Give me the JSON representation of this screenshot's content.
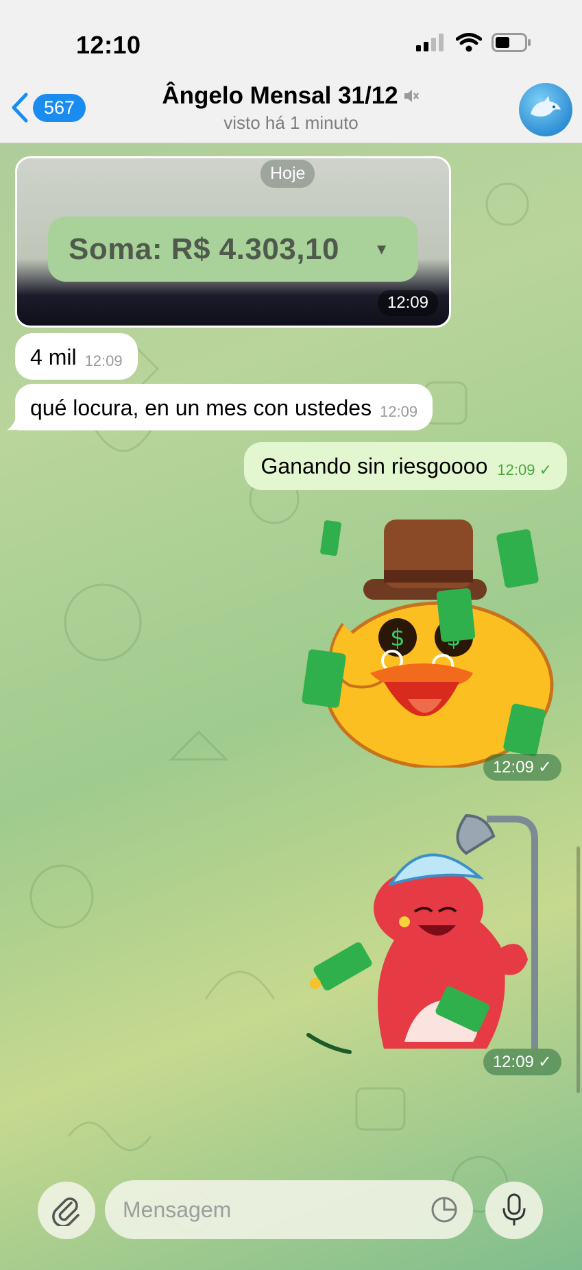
{
  "status_bar": {
    "time": "12:10"
  },
  "header": {
    "back_count": "567",
    "title": "Ângelo Mensal 31/12",
    "subtitle": "visto há 1 minuto"
  },
  "photo_message": {
    "date_chip": "Hoje",
    "image_text": "Soma: R$ 4.303,10",
    "time": "12:09"
  },
  "messages_in": [
    {
      "text": "4 mil",
      "time": "12:09"
    },
    {
      "text": "qué locura, en un mes con ustedes",
      "time": "12:09"
    }
  ],
  "message_out": {
    "text": "Ganando sin riesgoooo",
    "time": "12:09"
  },
  "stickers": [
    {
      "icon": "duck-money-sticker",
      "time": "12:09"
    },
    {
      "icon": "bear-shower-money-sticker",
      "time": "12:09"
    }
  ],
  "input": {
    "placeholder": "Mensagem"
  },
  "colors": {
    "accent": "#1a8cf0",
    "out_bubble": "#e2f7cf",
    "read_check": "#49a63f"
  }
}
